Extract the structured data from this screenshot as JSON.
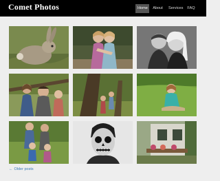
{
  "header": {
    "site_title": "Comet Photos",
    "nav": [
      {
        "label": "Home",
        "active": true
      },
      {
        "label": "About",
        "active": false
      },
      {
        "label": "Services",
        "active": false
      },
      {
        "label": "FAQ",
        "active": false
      }
    ]
  },
  "gallery": {
    "photos": [
      {
        "subject": "rabbit in grass"
      },
      {
        "subject": "two girls hugging"
      },
      {
        "subject": "mother and son black and white"
      },
      {
        "subject": "family under tree"
      },
      {
        "subject": "children by tree"
      },
      {
        "subject": "girl sitting on grass"
      },
      {
        "subject": "family of four on grass"
      },
      {
        "subject": "skull face paint black and white"
      },
      {
        "subject": "garden shed with flowers"
      }
    ]
  },
  "pagination": {
    "older_label": "Older posts",
    "arrow": "←"
  },
  "colors": {
    "header_bg": "#000000",
    "page_bg": "#eeeeee",
    "nav_active_bg": "#555555",
    "link": "#3a7ab8"
  }
}
